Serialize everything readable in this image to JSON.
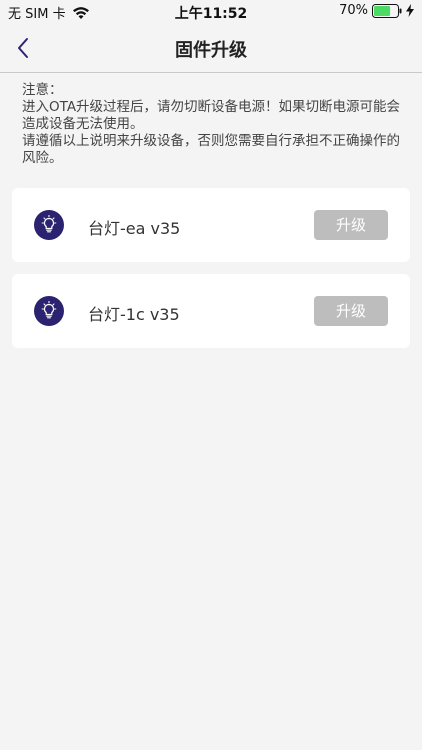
{
  "status_bar": {
    "carrier": "无 SIM 卡",
    "time": "上午11:52",
    "battery": "70%",
    "battery_level": 0.7,
    "battery_color": "#4cd964"
  },
  "nav": {
    "title": "固件升级",
    "back_icon": "chevron-left-icon"
  },
  "notice": {
    "line1": "注意：",
    "line2": "进入OTA升级过程后，请勿切断设备电源！如果切断电源可能会造成设备无法使用。",
    "line3": "请遵循以上说明来升级设备，否则您需要自行承担不正确操作的风险。"
  },
  "devices": [
    {
      "name": "台灯-ea v35",
      "button": "升级",
      "icon": "bulb-icon"
    },
    {
      "name": "台灯-1c v35",
      "button": "升级",
      "icon": "bulb-icon"
    }
  ],
  "colors": {
    "background": "#f4f4f4",
    "icon_circle": "#2b2370",
    "button_disabled": "#bdbdbd"
  }
}
